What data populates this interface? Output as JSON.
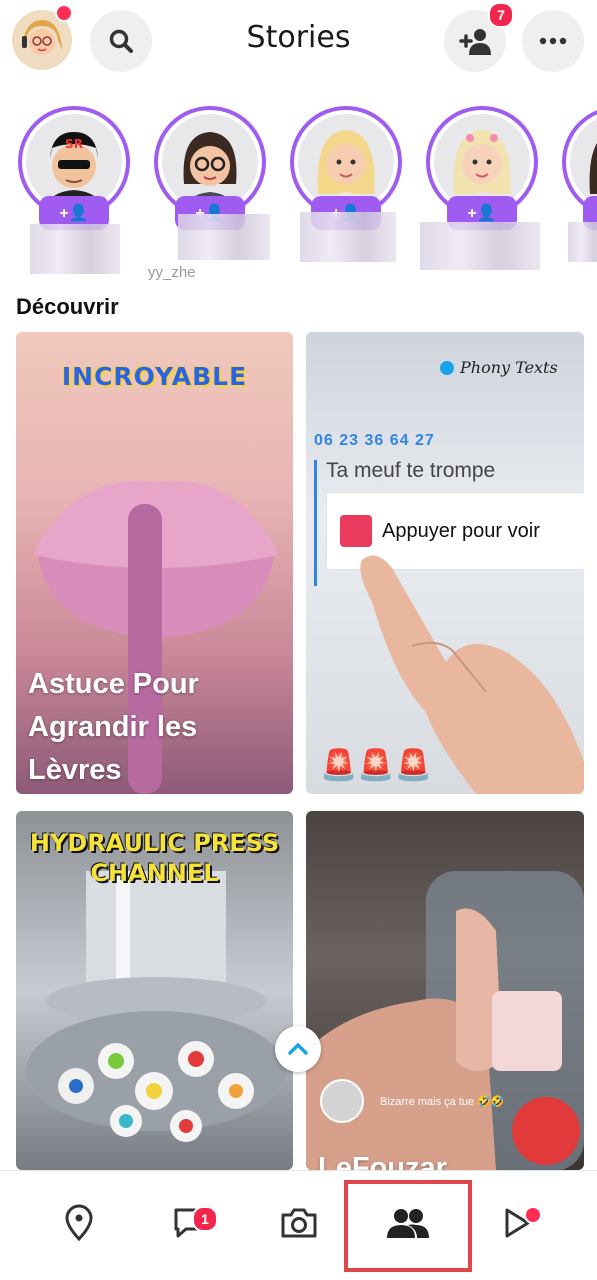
{
  "header": {
    "title": "Stories",
    "friend_requests_badge": "7",
    "avatar_name": "user-avatar",
    "accent_color": "#a05cf0",
    "badge_color": "#f2264c"
  },
  "stories": [
    {
      "name": "",
      "add_label": "+👤"
    },
    {
      "name": "yy_zhe",
      "add_label": "+👤"
    },
    {
      "name": "",
      "add_label": "+👤"
    },
    {
      "name": "",
      "add_label": "+👤"
    },
    {
      "name": "",
      "add_label": ""
    }
  ],
  "discover": {
    "section_title": "Découvrir",
    "cards": [
      {
        "title": "Astuce Pour Agrandir les Lèvres",
        "overlay": "INCROYABLE"
      },
      {
        "brand": "Phony Texts",
        "phone": "06 23 36 64 27",
        "message": "Ta meuf te trompe",
        "button_text": "Appuyer pour voir",
        "emojis": "🚨🚨🚨"
      },
      {
        "overlay_line1": "HYDRAULIC PRESS",
        "overlay_line2": "CHANNEL"
      },
      {
        "caption": "Bizarre mais ça tue 🤣🤣",
        "title": "LeFouzar"
      }
    ]
  },
  "scroll_up_label": "⌃",
  "nav": {
    "chat_badge": "1",
    "items": [
      "map",
      "chat",
      "camera",
      "stories",
      "spotlight"
    ]
  }
}
